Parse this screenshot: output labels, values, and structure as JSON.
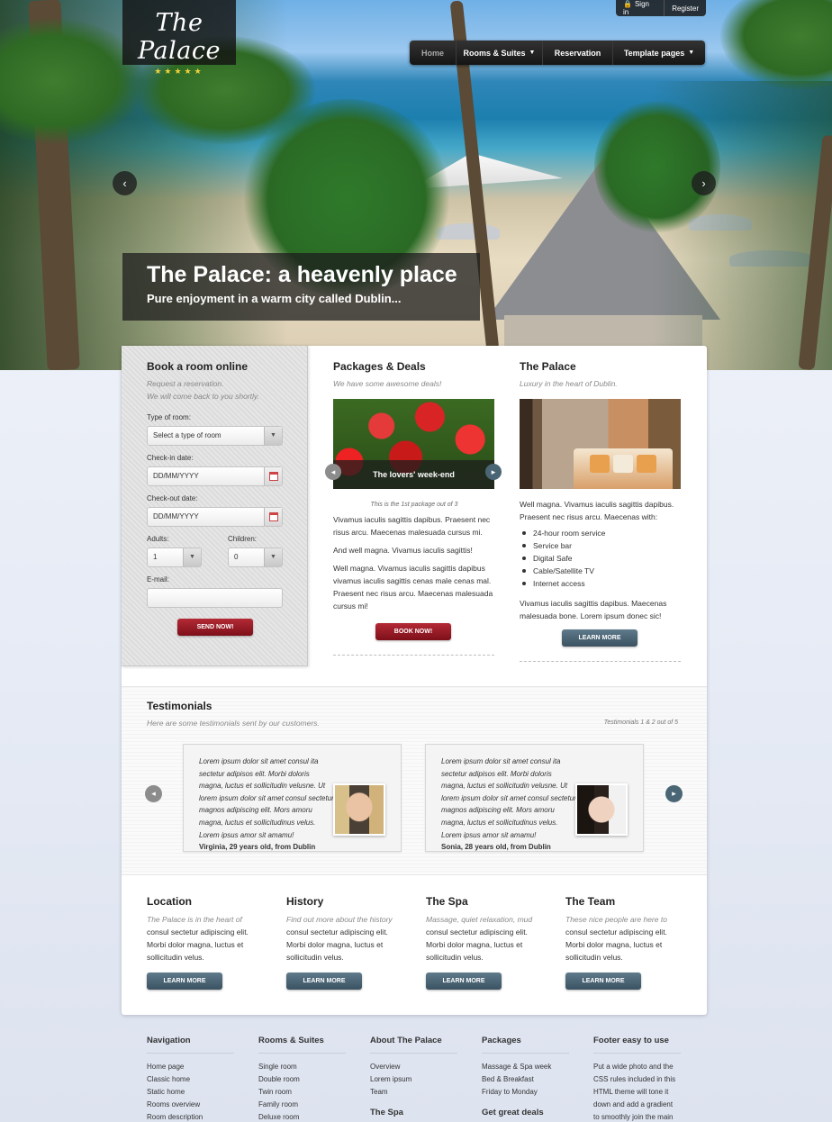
{
  "brand": {
    "name": "The Palace",
    "stars": "★★★★★"
  },
  "account": {
    "sign_in": "Sign in",
    "register": "Register"
  },
  "nav": {
    "items": [
      {
        "label": "Home",
        "dropdown": false
      },
      {
        "label": "Rooms & Suites",
        "dropdown": true
      },
      {
        "label": "Reservation",
        "dropdown": false
      },
      {
        "label": "Template pages",
        "dropdown": true
      }
    ]
  },
  "hero": {
    "title": "The Palace: a heavenly place",
    "subtitle": "Pure enjoyment in a warm city called Dublin..."
  },
  "booking": {
    "title": "Book a room online",
    "subtitle_line1": "Request a reservation.",
    "subtitle_line2": "We will come back to you shortly.",
    "room_type_label": "Type of room:",
    "room_type_value": "Select a type of room",
    "checkin_label": "Check-in date:",
    "checkin_value": "DD/MM/YYYY",
    "checkout_label": "Check-out date:",
    "checkout_value": "DD/MM/YYYY",
    "adults_label": "Adults:",
    "adults_value": "1",
    "children_label": "Children:",
    "children_value": "0",
    "email_label": "E-mail:",
    "email_value": "",
    "submit": "SEND NOW!"
  },
  "packages": {
    "title": "Packages & Deals",
    "subtitle": "We have some awesome deals!",
    "slide_caption": "The lovers' week-end",
    "counter": "This is the 1st package out of 3",
    "para1": "Vivamus iaculis sagittis dapibus. Praesent nec risus arcu. Maecenas malesuada cursus mi.",
    "para2": "And well magna. Vivamus iaculis sagittis!",
    "para3": "Well magna. Vivamus iaculis sagittis dapibus vivamus iaculis sagittis cenas male cenas mal. Praesent nec risus arcu. Maecenas malesuada cursus mi!",
    "button": "BOOK NOW!"
  },
  "palace": {
    "title": "The Palace",
    "subtitle": "Luxury in the heart of Dublin.",
    "intro": "Well magna. Vivamus iaculis sagittis dapibus. Praesent nec risus arcu. Maecenas with:",
    "amenities": [
      "24-hour room service",
      "Service bar",
      "Digital Safe",
      "Cable/Satellite TV",
      "Internet access"
    ],
    "outro": "Vivamus iaculis sagittis dapibus. Maecenas malesuada bone. Lorem ipsum donec sic!",
    "button": "LEARN MORE"
  },
  "testimonials": {
    "title": "Testimonials",
    "subtitle": "Here are some testimonials sent by our customers.",
    "counter": "Testimonials 1 & 2 out of 5",
    "items": [
      {
        "text": "Lorem ipsum dolor sit amet consul ita sectetur adipisos elit. Morbi doloris magna, luctus et sollicitudin velusne. Ut lorem ipsum dolor sit amet consul sectetur magnos adipiscing elit. Mors amoru magna, luctus et sollicitudinus velus. Lorem ipsus amor sit amamu!",
        "author": "Virginia, 29 years old, from Dublin"
      },
      {
        "text": "Lorem ipsum dolor sit amet consul ita sectetur adipisos elit. Morbi doloris magna, luctus et sollicitudin velusne. Ut lorem ipsum dolor sit amet consul sectetur magnos adipiscing elit. Mors amoru magna, luctus et sollicitudinus velus. Lorem ipsus amor sit amamu!",
        "author": "Sonia, 28 years old, from Dublin"
      }
    ]
  },
  "features": [
    {
      "title": "Location",
      "desc": "The Palace is in the heart of",
      "body": "consul sectetur adipiscing elit. Morbi dolor magna, luctus et sollicitudin velus.",
      "button": "LEARN MORE"
    },
    {
      "title": "History",
      "desc": "Find out more about the history",
      "body": "consul sectetur adipiscing elit. Morbi dolor magna, luctus et sollicitudin velus.",
      "button": "LEARN MORE"
    },
    {
      "title": "The Spa",
      "desc": "Massage, quiet relaxation, mud",
      "body": "consul sectetur adipiscing elit. Morbi dolor magna, luctus et sollicitudin velus.",
      "button": "LEARN MORE"
    },
    {
      "title": "The Team",
      "desc": "These nice people are here to",
      "body": "consul sectetur adipiscing elit. Morbi dolor magna, luctus et sollicitudin velus.",
      "button": "LEARN MORE"
    }
  ],
  "footer": {
    "columns": [
      {
        "title": "Navigation",
        "links": [
          "Home page",
          "Classic home",
          "Static home",
          "Rooms overview",
          "Room description"
        ]
      },
      {
        "title": "Rooms & Suites",
        "links": [
          "Single room",
          "Double room",
          "Twin room",
          "Family room",
          "Deluxe room"
        ]
      },
      {
        "title": "About The Palace",
        "links": [
          "Overview",
          "Lorem ipsum",
          "Team"
        ],
        "subtitle": "The Spa"
      },
      {
        "title": "Packages",
        "links": [
          "Massage & Spa week",
          "Bed & Breakfast",
          "Friday to Monday"
        ],
        "subtitle": "Get great deals"
      },
      {
        "title": "Footer easy to use",
        "text_lines": [
          "Put a wide photo and the",
          "CSS rules included in this",
          "HTML theme will tone it",
          "down and add a gradient",
          "to smoothly join the main"
        ]
      }
    ]
  },
  "colors": {
    "accent_red": "#8e1520",
    "accent_blue": "#46606f",
    "nav_dark": "#1c1c1c",
    "star_yellow": "#f2d03b"
  }
}
